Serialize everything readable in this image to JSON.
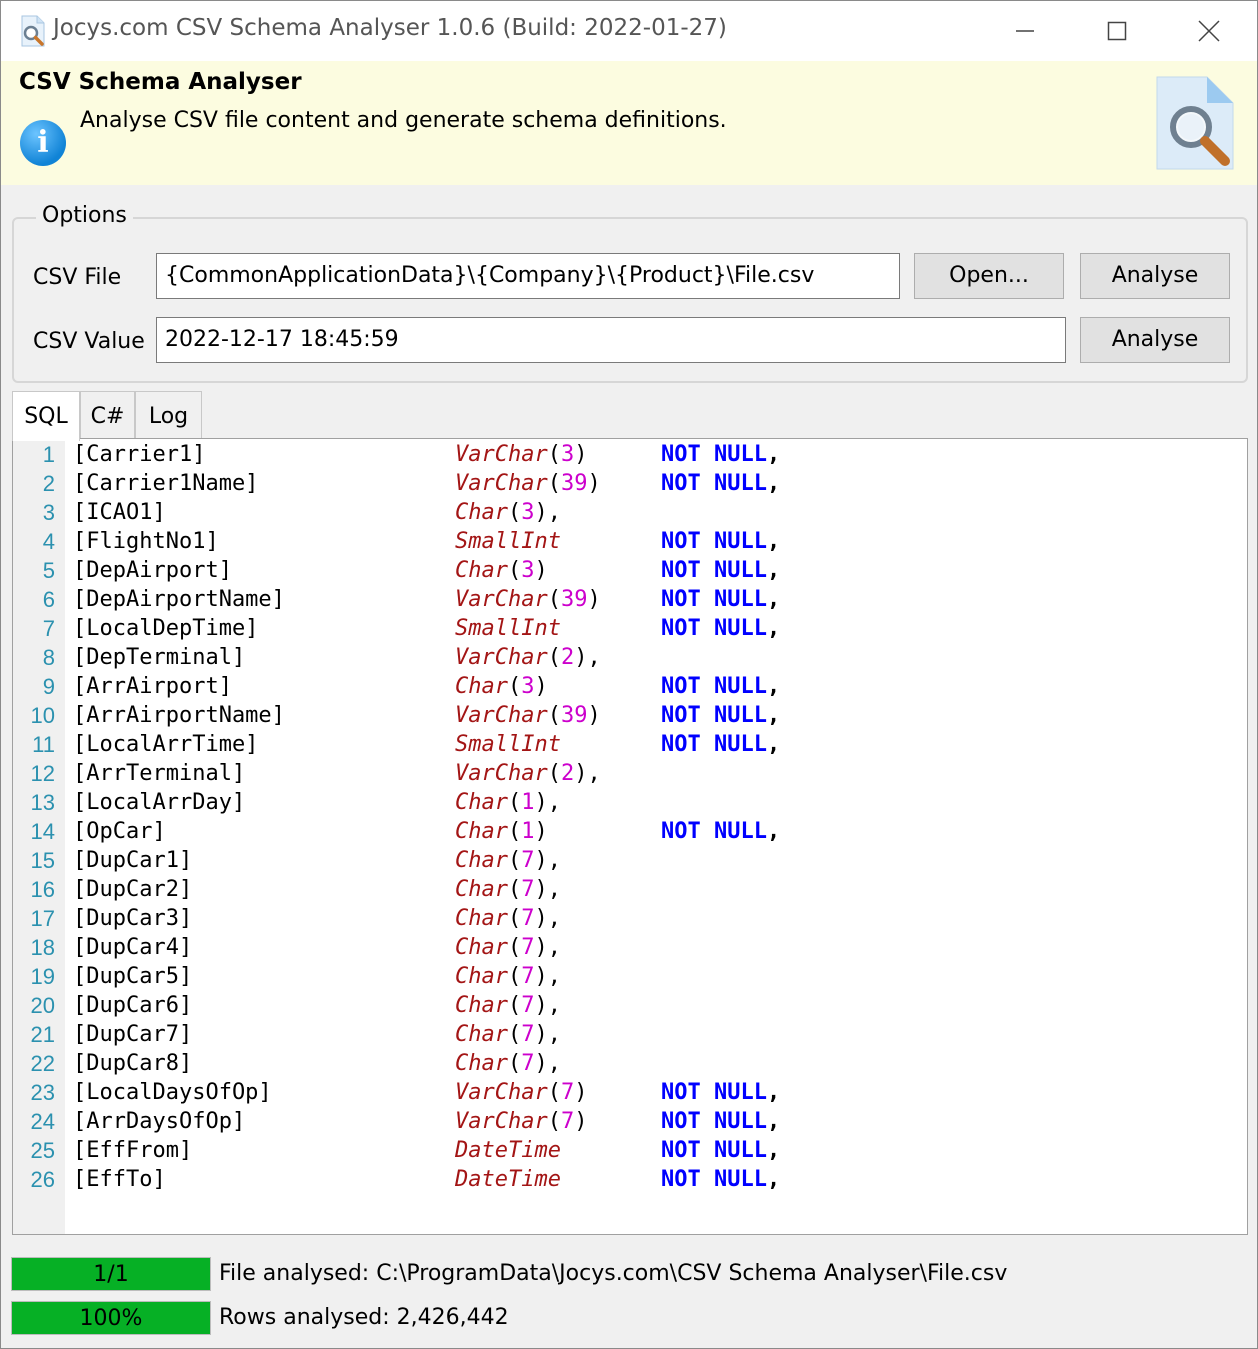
{
  "window": {
    "title": "Jocys.com CSV Schema Analyser 1.0.6 (Build: 2022-01-27)",
    "minimize_glyph": "—",
    "maximize_glyph": "□",
    "close_glyph": "✕"
  },
  "header": {
    "title": "CSV Schema Analyser",
    "description": "Analyse CSV file content and generate schema definitions.",
    "info_icon_glyph": "i"
  },
  "options": {
    "legend": "Options",
    "csv_file_label": "CSV File",
    "csv_file_value": "{CommonApplicationData}\\{Company}\\{Product}\\File.csv",
    "open_button": "Open...",
    "analyse_file_button": "Analyse",
    "csv_value_label": "CSV Value",
    "csv_value_value": "2022-12-17 18:45:59",
    "analyse_value_button": "Analyse"
  },
  "tabs": [
    {
      "label": "SQL",
      "active": true
    },
    {
      "label": "C#",
      "active": false
    },
    {
      "label": "Log",
      "active": false
    }
  ],
  "sql_lines": [
    {
      "n": "1",
      "name": "[Carrier1]",
      "type": "VarChar",
      "size": "3",
      "tail": ")",
      "nn": true
    },
    {
      "n": "2",
      "name": "[Carrier1Name]",
      "type": "VarChar",
      "size": "39",
      "tail": ")",
      "nn": true
    },
    {
      "n": "3",
      "name": "[ICAO1]",
      "type": "Char",
      "size": "3",
      "tail": "),",
      "nn": false
    },
    {
      "n": "4",
      "name": "[FlightNo1]",
      "type": "SmallInt",
      "size": "",
      "tail": "",
      "nn": true
    },
    {
      "n": "5",
      "name": "[DepAirport]",
      "type": "Char",
      "size": "3",
      "tail": ")",
      "nn": true
    },
    {
      "n": "6",
      "name": "[DepAirportName]",
      "type": "VarChar",
      "size": "39",
      "tail": ")",
      "nn": true
    },
    {
      "n": "7",
      "name": "[LocalDepTime]",
      "type": "SmallInt",
      "size": "",
      "tail": "",
      "nn": true
    },
    {
      "n": "8",
      "name": "[DepTerminal]",
      "type": "VarChar",
      "size": "2",
      "tail": "),",
      "nn": false
    },
    {
      "n": "9",
      "name": "[ArrAirport]",
      "type": "Char",
      "size": "3",
      "tail": ")",
      "nn": true
    },
    {
      "n": "10",
      "name": "[ArrAirportName]",
      "type": "VarChar",
      "size": "39",
      "tail": ")",
      "nn": true
    },
    {
      "n": "11",
      "name": "[LocalArrTime]",
      "type": "SmallInt",
      "size": "",
      "tail": "",
      "nn": true
    },
    {
      "n": "12",
      "name": "[ArrTerminal]",
      "type": "VarChar",
      "size": "2",
      "tail": "),",
      "nn": false
    },
    {
      "n": "13",
      "name": "[LocalArrDay]",
      "type": "Char",
      "size": "1",
      "tail": "),",
      "nn": false
    },
    {
      "n": "14",
      "name": "[OpCar]",
      "type": "Char",
      "size": "1",
      "tail": ")",
      "nn": true
    },
    {
      "n": "15",
      "name": "[DupCar1]",
      "type": "Char",
      "size": "7",
      "tail": "),",
      "nn": false
    },
    {
      "n": "16",
      "name": "[DupCar2]",
      "type": "Char",
      "size": "7",
      "tail": "),",
      "nn": false
    },
    {
      "n": "17",
      "name": "[DupCar3]",
      "type": "Char",
      "size": "7",
      "tail": "),",
      "nn": false
    },
    {
      "n": "18",
      "name": "[DupCar4]",
      "type": "Char",
      "size": "7",
      "tail": "),",
      "nn": false
    },
    {
      "n": "19",
      "name": "[DupCar5]",
      "type": "Char",
      "size": "7",
      "tail": "),",
      "nn": false
    },
    {
      "n": "20",
      "name": "[DupCar6]",
      "type": "Char",
      "size": "7",
      "tail": "),",
      "nn": false
    },
    {
      "n": "21",
      "name": "[DupCar7]",
      "type": "Char",
      "size": "7",
      "tail": "),",
      "nn": false
    },
    {
      "n": "22",
      "name": "[DupCar8]",
      "type": "Char",
      "size": "7",
      "tail": "),",
      "nn": false
    },
    {
      "n": "23",
      "name": "[LocalDaysOfOp]",
      "type": "VarChar",
      "size": "7",
      "tail": ")",
      "nn": true
    },
    {
      "n": "24",
      "name": "[ArrDaysOfOp]",
      "type": "VarChar",
      "size": "7",
      "tail": ")",
      "nn": true
    },
    {
      "n": "25",
      "name": "[EffFrom]",
      "type": "DateTime",
      "size": "",
      "tail": "",
      "nn": true
    },
    {
      "n": "26",
      "name": "[EffTo]",
      "type": "DateTime",
      "size": "",
      "tail": "",
      "nn": true
    }
  ],
  "sql_syntax": {
    "not": "NOT",
    "null": "NULL",
    "comma": ",",
    "open_paren": "("
  },
  "status": {
    "files_progress_text": "1/1",
    "files_progress_fraction": 1.0,
    "file_status": "File analysed: C:\\ProgramData\\Jocys.com\\CSV Schema Analyser\\File.csv",
    "rows_progress_text": "100%",
    "rows_progress_fraction": 1.0,
    "rows_status": "Rows analysed: 2,426,442"
  },
  "colors": {
    "progress_green": "#06b025",
    "header_background": "#fcfce0",
    "keyword_blue": "#0000ff",
    "type_red": "#a31515",
    "number_magenta": "#cc00cc",
    "line_number_teal": "#2b91af"
  },
  "icons": {
    "app_icon": "magnifier-document-icon",
    "info_icon": "info-icon",
    "banner_icon": "document-search-icon"
  }
}
